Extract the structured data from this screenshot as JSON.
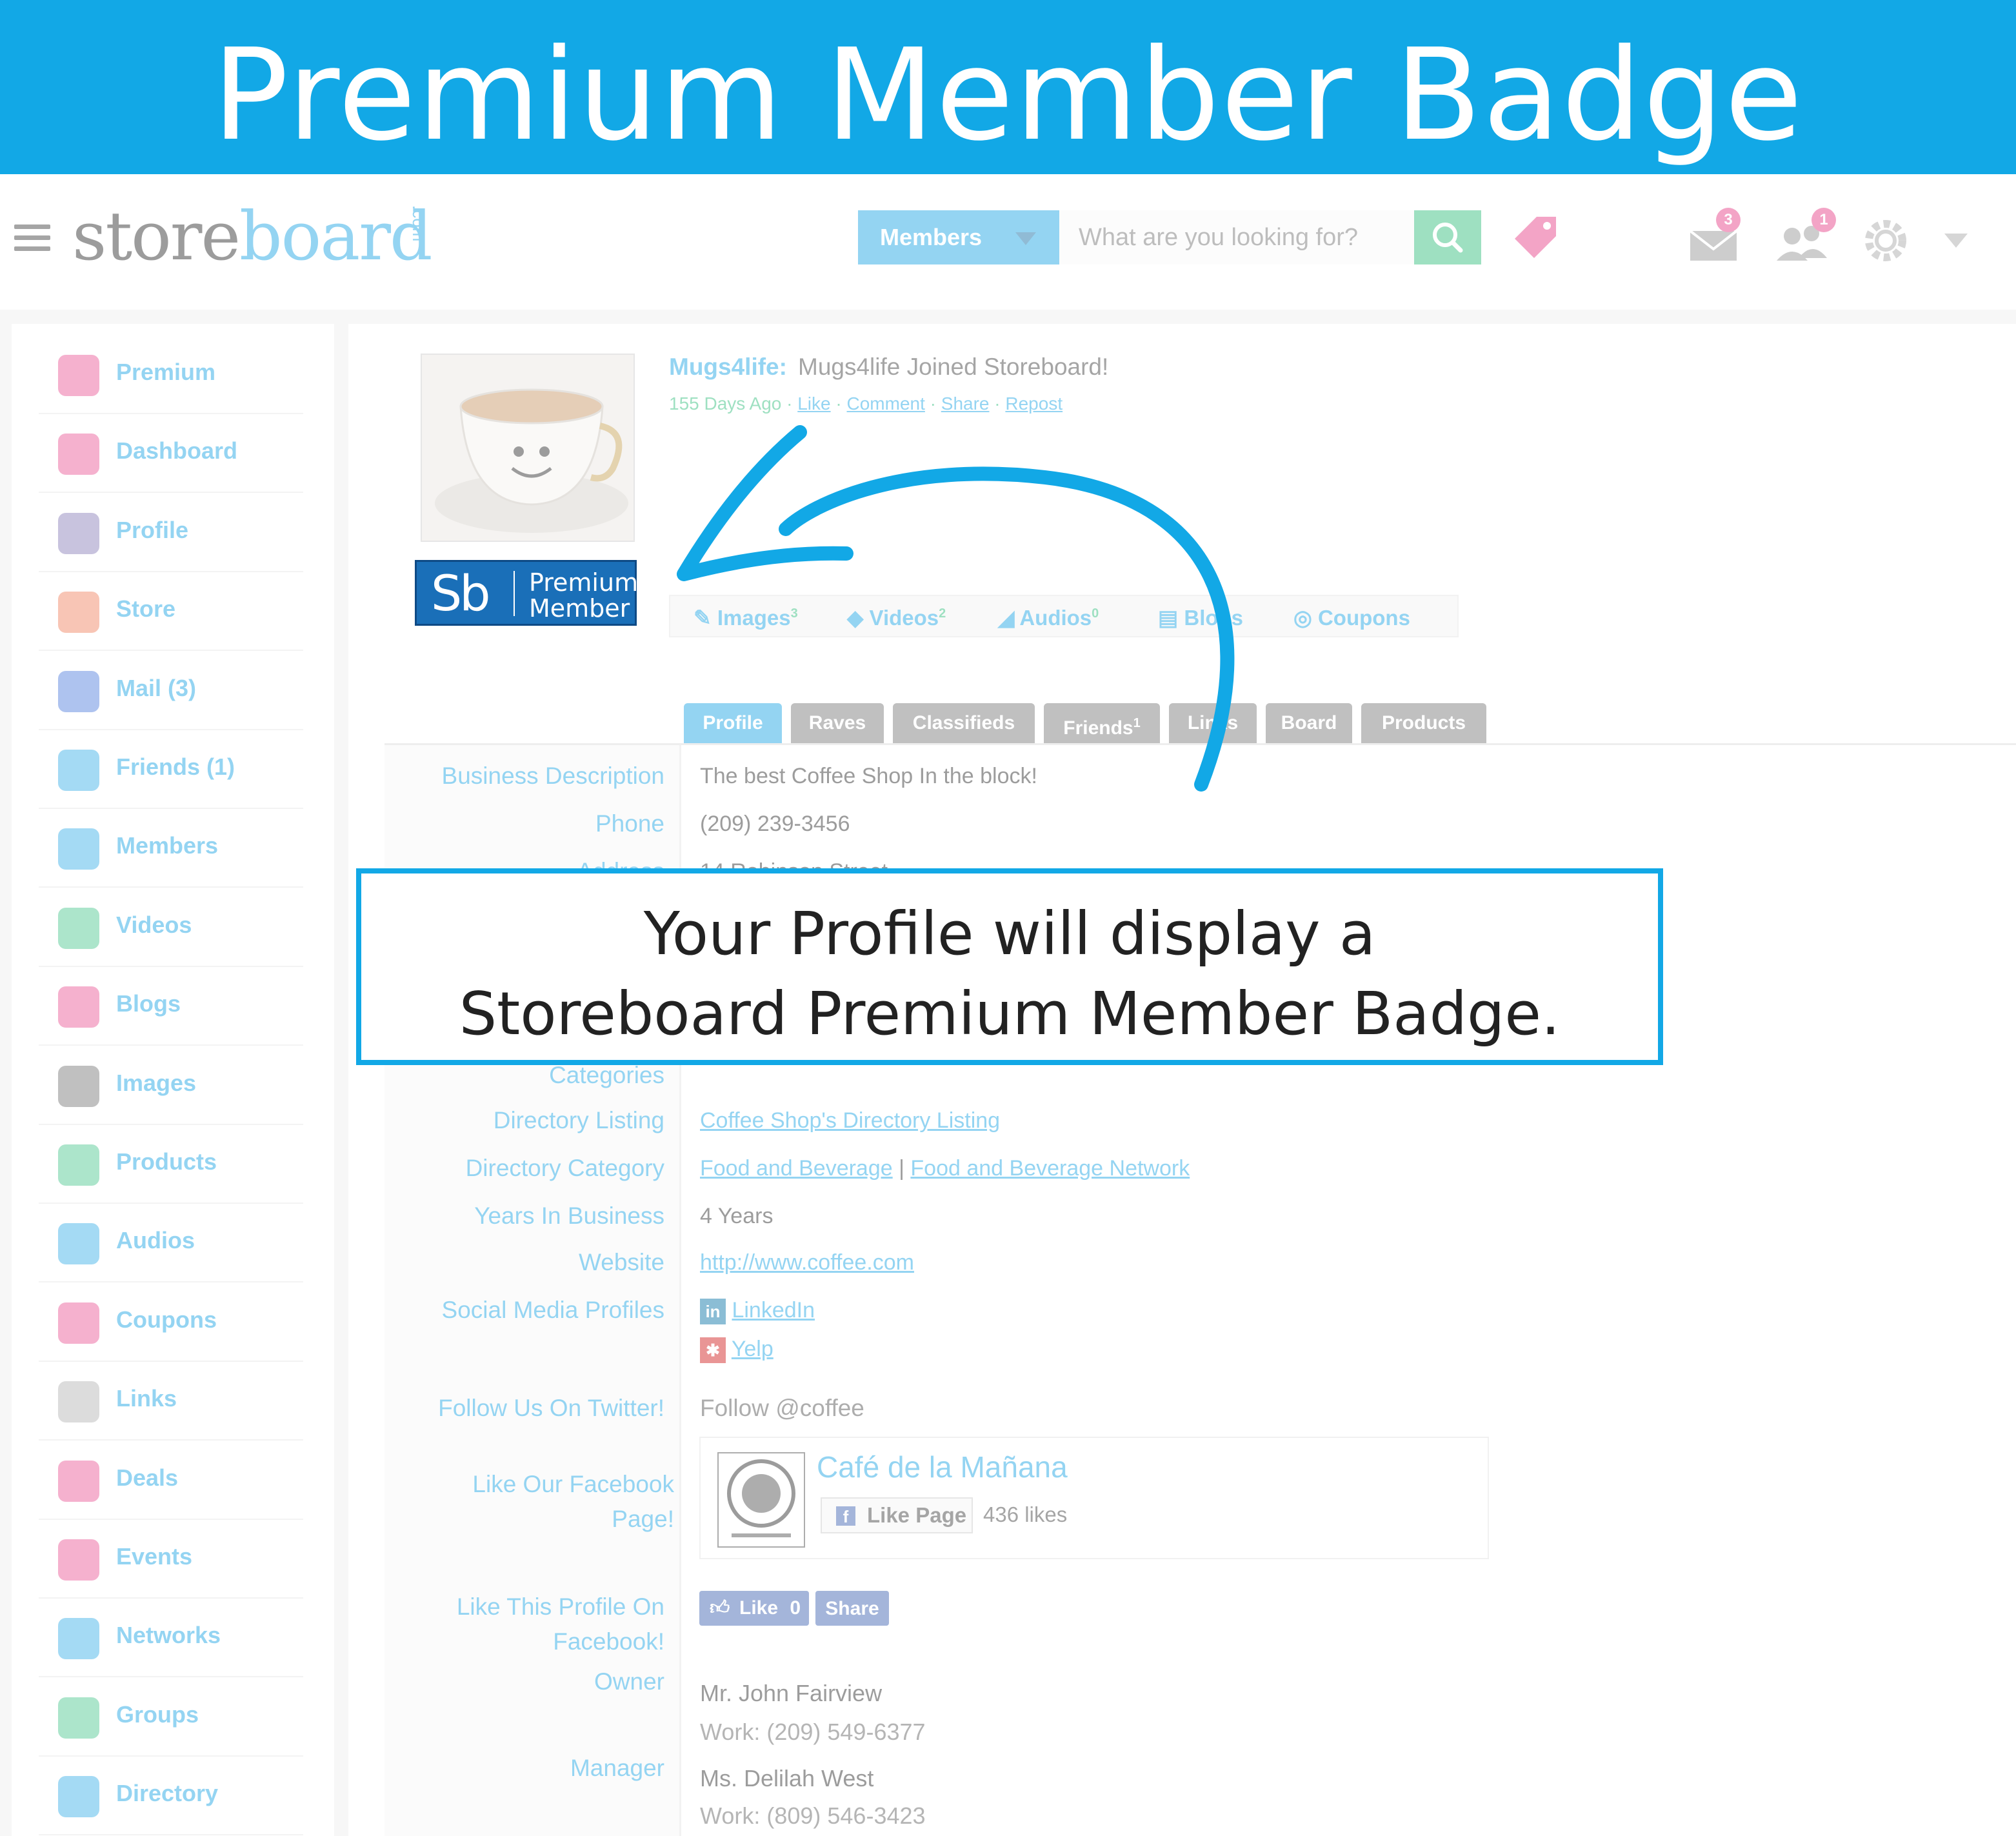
{
  "banner": {
    "title": "Premium Member Badge"
  },
  "header": {
    "logo_part1": "store",
    "logo_part2": "board",
    "logo_suffix": ".com",
    "search_category": "Members",
    "search_placeholder": "What are you looking for?",
    "mail_count": "3",
    "friends_count": "1",
    "icons": [
      "menu-icon",
      "search-icon",
      "tag-icon",
      "mail-icon",
      "friends-icon",
      "settings-icon",
      "chevron-down-icon"
    ]
  },
  "sidebar": {
    "items": [
      {
        "label": "Premium",
        "icon": "premium-icon",
        "color": "#e8428a"
      },
      {
        "label": "Dashboard",
        "icon": "dashboard-icon",
        "color": "#e8428a"
      },
      {
        "label": "Profile",
        "icon": "profile-icon",
        "color": "#7a6fb0"
      },
      {
        "label": "Store",
        "icon": "store-icon",
        "color": "#f0734a"
      },
      {
        "label": "Mail (3)",
        "icon": "mail-icon",
        "color": "#3a6fd8"
      },
      {
        "label": "Friends (1)",
        "icon": "friends-icon",
        "color": "#21a7e6"
      },
      {
        "label": "Members",
        "icon": "members-icon",
        "color": "#21a7e6"
      },
      {
        "label": "Videos",
        "icon": "videos-icon",
        "color": "#36c080"
      },
      {
        "label": "Blogs",
        "icon": "blogs-icon",
        "color": "#e8428a"
      },
      {
        "label": "Images",
        "icon": "images-icon",
        "color": "#666666"
      },
      {
        "label": "Products",
        "icon": "products-icon",
        "color": "#36c080"
      },
      {
        "label": "Audios",
        "icon": "audios-icon",
        "color": "#21a7e6"
      },
      {
        "label": "Coupons",
        "icon": "coupons-icon",
        "color": "#e8428a"
      },
      {
        "label": "Links",
        "icon": "links-icon",
        "color": "#aaaaaa"
      },
      {
        "label": "Deals",
        "icon": "deals-icon",
        "color": "#e8428a"
      },
      {
        "label": "Events",
        "icon": "events-icon",
        "color": "#e8428a"
      },
      {
        "label": "Networks",
        "icon": "networks-icon",
        "color": "#21a7e6"
      },
      {
        "label": "Groups",
        "icon": "groups-icon",
        "color": "#36c080"
      },
      {
        "label": "Directory",
        "icon": "directory-icon",
        "color": "#21a7e6"
      }
    ]
  },
  "profile": {
    "badge_logo": "Sb",
    "badge_line1": "Premium",
    "badge_line2": "Member",
    "post_author": "Mugs4life:",
    "post_text": "Mugs4life Joined Storeboard!",
    "post_time": "155 Days Ago",
    "post_actions": [
      "Like",
      "Comment",
      "Share",
      "Repost"
    ]
  },
  "media_bar": [
    {
      "label": "Images",
      "count": "3",
      "icon": "images-icon"
    },
    {
      "label": "Videos",
      "count": "2",
      "icon": "videos-icon"
    },
    {
      "label": "Audios",
      "count": "0",
      "icon": "audios-icon"
    },
    {
      "label": "Blogs",
      "count": "",
      "icon": "blogs-icon"
    },
    {
      "label": "Coupons",
      "count": "",
      "icon": "coupons-icon"
    }
  ],
  "tabs": [
    {
      "label": "Profile",
      "badge": ""
    },
    {
      "label": "Raves",
      "badge": ""
    },
    {
      "label": "Classifieds",
      "badge": ""
    },
    {
      "label": "Friends",
      "badge": "1"
    },
    {
      "label": "Links",
      "badge": ""
    },
    {
      "label": "Board",
      "badge": ""
    },
    {
      "label": "Products",
      "badge": ""
    }
  ],
  "fields": [
    {
      "label": "Business Description",
      "value": "The best Coffee Shop In the block!"
    },
    {
      "label": "Phone",
      "value": "(209) 239-3456"
    },
    {
      "label": "Address",
      "value": "14 Robinson Street"
    },
    {
      "label": "Categories",
      "value": ""
    },
    {
      "label": "Directory Listing",
      "value": "Coffee Shop's Directory Listing"
    },
    {
      "label": "Directory Category",
      "value": "Food and Beverage",
      "value2": "Food and Beverage Network"
    },
    {
      "label": "Years In Business",
      "value": "4 Years"
    },
    {
      "label": "Website",
      "value": "http://www.coffee.com"
    },
    {
      "label": "Social Media Profiles",
      "value": "LinkedIn",
      "value2": "Yelp"
    },
    {
      "label": "Follow Us On Twitter!",
      "value": "Follow @coffee"
    },
    {
      "label": "Like Our Facebook Page!",
      "value": ""
    },
    {
      "label": "Like This Profile On Facebook!",
      "value": ""
    },
    {
      "label": "Owner",
      "value": "Mr. John Fairview",
      "value2": "Work: (209) 549-6377"
    },
    {
      "label": "Manager",
      "value": "Ms. Delilah West",
      "value2": "Work: (809) 546-3423"
    }
  ],
  "facebook_widget": {
    "page_name": "Café de la Mañana",
    "like_page_label": "Like Page",
    "likes_text": "436 likes"
  },
  "fb_buttons": {
    "like_label": "Like",
    "like_count": "0",
    "share_label": "Share"
  },
  "callout": {
    "line1": "Your Profile will display a",
    "line2": "Storeboard Premium Member Badge."
  },
  "colors": {
    "banner": "#12a8e6",
    "accent_blue": "#21a7e6",
    "accent_green": "#36c080",
    "accent_pink": "#e8428a"
  }
}
